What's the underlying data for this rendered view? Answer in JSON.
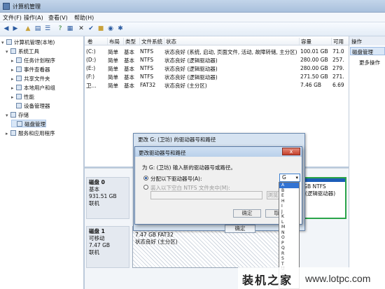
{
  "window": {
    "title": "计算机管理"
  },
  "menu": [
    "文件(F)",
    "操作(A)",
    "查看(V)",
    "帮助(H)"
  ],
  "toolbar_icons": [
    "back-arrow-icon",
    "forward-arrow-icon",
    "up-folder-icon",
    "show-tree-icon",
    "list-view-icon",
    "help-icon",
    "properties-icon",
    "delete-icon",
    "folder-icon",
    "magnifier-icon",
    "settings-icon"
  ],
  "tree": [
    {
      "label": "计算机管理(本地)",
      "level": 0,
      "twisty": "▾"
    },
    {
      "label": "系统工具",
      "level": 1,
      "twisty": "▾"
    },
    {
      "label": "任务计划程序",
      "level": 2,
      "twisty": "▸"
    },
    {
      "label": "事件查看器",
      "level": 2,
      "twisty": "▸"
    },
    {
      "label": "共享文件夹",
      "level": 2,
      "twisty": "▸"
    },
    {
      "label": "本地用户和组",
      "level": 2,
      "twisty": "▸"
    },
    {
      "label": "性能",
      "level": 2,
      "twisty": "▸"
    },
    {
      "label": "设备管理器",
      "level": 2,
      "twisty": ""
    },
    {
      "label": "存储",
      "level": 1,
      "twisty": "▾"
    },
    {
      "label": "磁盘管理",
      "level": 2,
      "twisty": "",
      "selected": true
    },
    {
      "label": "服务和应用程序",
      "level": 1,
      "twisty": "▸"
    }
  ],
  "volume_table": {
    "columns": [
      "卷",
      "布局",
      "类型",
      "文件系统",
      "状态",
      "容量",
      "可用"
    ],
    "rows": [
      [
        "(C:)",
        "简单",
        "基本",
        "NTFS",
        "状态良好 (系统, 启动, 页面文件, 活动, 故障转储, 主分区)",
        "100.01 GB",
        "71.0"
      ],
      [
        "(D:)",
        "简单",
        "基本",
        "NTFS",
        "状态良好 (逻辑驱动器)",
        "280.00 GB",
        "257."
      ],
      [
        "(E:)",
        "简单",
        "基本",
        "NTFS",
        "状态良好 (逻辑驱动器)",
        "280.00 GB",
        "279."
      ],
      [
        "(F:)",
        "简单",
        "基本",
        "NTFS",
        "状态良好 (逻辑驱动器)",
        "271.50 GB",
        "271."
      ],
      [
        "卫...",
        "简单",
        "基本",
        "FAT32",
        "状态良好 (主分区)",
        "7.46 GB",
        "6.69"
      ]
    ]
  },
  "actions": {
    "header": "操作",
    "selected": "磁盘管理",
    "more": "更多操作"
  },
  "disks": [
    {
      "name": "磁盘 0",
      "type": "基本",
      "size": "931.51 GB",
      "status": "联机"
    },
    {
      "name": "磁盘 1",
      "type": "可移动",
      "size": "7.47 GB",
      "status": "联机"
    }
  ],
  "disk_parts": {
    "disk0_right": "0 GB NTFS\n好 (逻辑驱动器)",
    "disk1_part": "7.47 GB FAT32\n状态良好 (主分区)"
  },
  "dialog_outer": {
    "title": "更改 G: (卫坊) 的驱动器号和路径",
    "ok": "确定"
  },
  "dialog_inner": {
    "title": "更改驱动器号和路径",
    "close": "x",
    "description": "为 G: (卫坊) 输入新的驱动器号或路径。",
    "option_assign": "分配以下驱动器号(A):",
    "option_mount": "装入以下空白 NTFS 文件夹中(M):",
    "selected_letter": "G",
    "browse": "浏览(R)...",
    "ok": "确定",
    "cancel": "取消"
  },
  "drive_letters": [
    "A",
    "B",
    "E",
    "H",
    "I",
    "J",
    "K",
    "L",
    "M",
    "N",
    "O",
    "P",
    "Q",
    "R",
    "S",
    "T",
    "U",
    "V",
    "W",
    "X",
    "Y",
    "Z"
  ],
  "watermark": {
    "text": "装机之家",
    "url": "www.lotpc.com"
  }
}
